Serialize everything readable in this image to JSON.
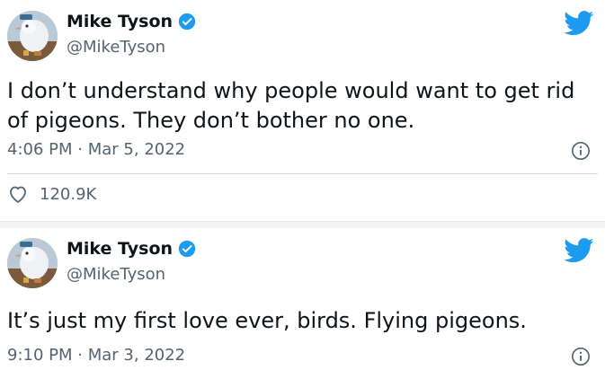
{
  "tweets": [
    {
      "author_name": "Mike Tyson",
      "handle": "@MikeTyson",
      "text": "I don’t understand why people would want to get rid of pigeons. They don’t bother no one.",
      "time": "4:06 PM",
      "dot": "·",
      "date": "Mar 5, 2022",
      "likes": "120.9K",
      "verified": true
    },
    {
      "author_name": "Mike Tyson",
      "handle": "@MikeTyson",
      "text": "It’s just my first love ever, birds. Flying pigeons.",
      "time": "9:10 PM",
      "dot": "·",
      "date": "Mar 3, 2022",
      "verified": true
    }
  ],
  "icons": {
    "brand": "twitter-bird-icon",
    "verified": "verified-badge-icon",
    "info": "info-icon",
    "like": "heart-icon"
  },
  "colors": {
    "twitter_blue": "#1d9bf0",
    "text": "#0f1419",
    "muted": "#536471",
    "divider": "#cfd9de"
  }
}
